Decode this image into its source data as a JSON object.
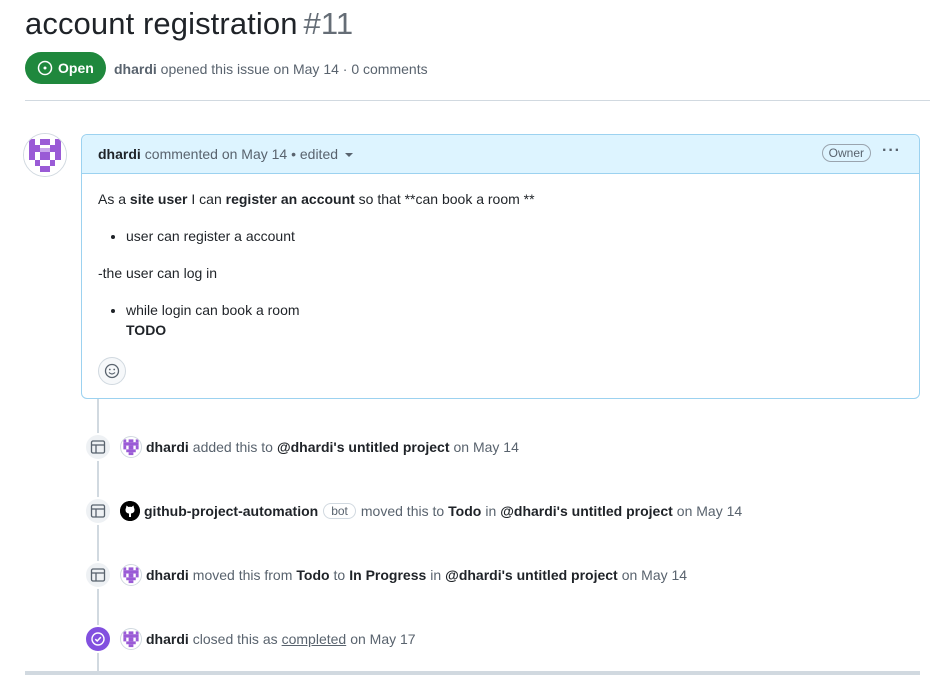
{
  "issue": {
    "title": "account registration",
    "number": "#11",
    "state": "Open",
    "author": "dhardi",
    "meta_text": "opened this issue on May 14 · 0 comments"
  },
  "comment": {
    "author": "dhardi",
    "meta": "commented on May 14 • edited",
    "badge": "Owner",
    "more": "···",
    "p1": {
      "a": "As a ",
      "b1": "site user",
      "c": " I can ",
      "b2": "register an account",
      "d": " so that **can book a room **"
    },
    "list1": [
      "user can register a account"
    ],
    "p2": "-the user can log in",
    "list2_item": "while login can book a room",
    "list2_bold": "TODO"
  },
  "events": [
    {
      "actor": "dhardi",
      "parts": [
        "added this to",
        "@dhardi's untitled project",
        "on May 14"
      ]
    },
    {
      "actor": "github-project-automation",
      "bot": "bot",
      "parts": [
        "moved this to",
        "Todo",
        "in",
        "@dhardi's untitled project",
        "on May 14"
      ]
    },
    {
      "actor": "dhardi",
      "parts": [
        "moved this from",
        "Todo",
        "to",
        "In Progress",
        "in",
        "@dhardi's untitled project",
        "on May 14"
      ]
    },
    {
      "actor": "dhardi",
      "parts": [
        "closed this as",
        "completed",
        "on May 17"
      ]
    }
  ],
  "colors": {
    "open": "#1f883d",
    "closed": "#8250df",
    "comment_border": "#9cd2f0",
    "comment_header": "#ddf4ff"
  }
}
